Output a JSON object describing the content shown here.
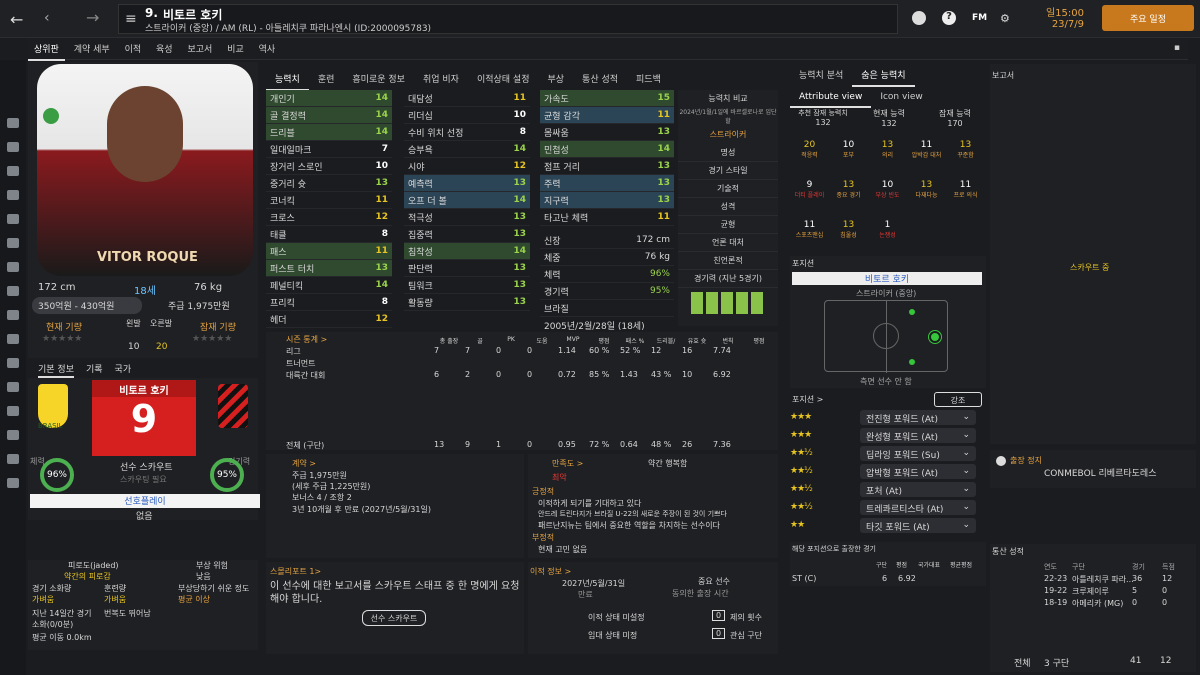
{
  "header": {
    "player_number": "9.",
    "player_name": "비토르 호키",
    "subtitle": "스트라이커 (중앙) / AM (RL) - 아틀레치쿠 파라나엔시 (ID:2000095783)",
    "time": "일15:00",
    "date": "23/7/9",
    "continue_label": "주요 일정",
    "fm_label": "FM"
  },
  "nav": [
    "상위판",
    "계약 세부",
    "이적",
    "육성",
    "보고서",
    "비교",
    "역사"
  ],
  "profile": {
    "height": "172 cm",
    "age": "18세",
    "weight": "76 kg",
    "value": "350억원 - 430억원",
    "wage": "주급 1,975만원",
    "current_ability_label": "현재 기량",
    "potential_label": "잠재 기량",
    "left_foot_label": "왼발",
    "right_foot_label": "오른발",
    "left_foot_val": "10",
    "right_foot_val": "20",
    "shirt_name": "VITOR ROQUE"
  },
  "tabs_info": [
    "기본 정보",
    "기록",
    "국가"
  ],
  "card": {
    "name": "비토르 호키",
    "number": "9",
    "scout_label": "선수 스카우트",
    "scout_sub": "스카우팅 필요",
    "left_pct": "96%",
    "right_pct": "95%",
    "left_label": "체력",
    "right_label": "경기력",
    "role_btn": "선호플레이",
    "role_val": "없음",
    "country": "BRASIL"
  },
  "condition": {
    "l1": "피로도(jaded)",
    "l1v": "약간의 피로감",
    "l2": "부상 위험",
    "l2v": "낮음",
    "l3": "경기 소화량",
    "l3v": "가벼움",
    "l4": "훈련량",
    "l4v": "가벼움",
    "l5": "부상당하기 쉬운 정도",
    "l5v": "평균 이상",
    "l6": "지난 14일간 경기",
    "l7": "소화(0/0분)",
    "l8": "번복도 뛰어남",
    "l9": "평균 이동 0.0km"
  },
  "attr_tabs": [
    "능력치",
    "훈련",
    "흥미로운 정보",
    "취업 비자",
    "이적상태 설정",
    "부상",
    "통산 성적",
    "피드백"
  ],
  "attrs_col1": [
    [
      "개인기",
      "14"
    ],
    [
      "골 결정력",
      "14"
    ],
    [
      "드리블",
      "14"
    ],
    [
      "일대일마크",
      "7"
    ],
    [
      "장거리 스로인",
      "10"
    ],
    [
      "중거리 슛",
      "13"
    ],
    [
      "코너킥",
      "11"
    ],
    [
      "크로스",
      "12"
    ],
    [
      "태클",
      "8"
    ],
    [
      "패스",
      "11"
    ],
    [
      "퍼스트 터치",
      "13"
    ],
    [
      "페널티킥",
      "14"
    ],
    [
      "프리킥",
      "8"
    ],
    [
      "헤더",
      "12"
    ]
  ],
  "attrs_col2": [
    [
      "대담성",
      "11"
    ],
    [
      "리더십",
      "10"
    ],
    [
      "수비 위치 선정",
      "8"
    ],
    [
      "승부욕",
      "14"
    ],
    [
      "시야",
      "12"
    ],
    [
      "예측력",
      "13"
    ],
    [
      "오프 더 볼",
      "14"
    ],
    [
      "적극성",
      "13"
    ],
    [
      "집중력",
      "13"
    ],
    [
      "침착성",
      "14"
    ],
    [
      "판단력",
      "13"
    ],
    [
      "팀워크",
      "13"
    ],
    [
      "활동량",
      "13"
    ]
  ],
  "attrs_col3": [
    [
      "가속도",
      "15"
    ],
    [
      "균형 감각",
      "11"
    ],
    [
      "몸싸움",
      "13"
    ],
    [
      "민첩성",
      "14"
    ],
    [
      "점프 거리",
      "13"
    ],
    [
      "주력",
      "13"
    ],
    [
      "지구력",
      "13"
    ],
    [
      "타고난 체력",
      "11"
    ]
  ],
  "phys": [
    [
      "신장",
      "172 cm"
    ],
    [
      "체중",
      "76 kg"
    ],
    [
      "체력",
      "96%"
    ],
    [
      "경기력",
      "95%"
    ]
  ],
  "phys_birth": "2005년/2월/28일 (18세)",
  "phys_nation": "브라질",
  "compare": {
    "title": "능력치 비교",
    "sub": "2024년/1월/1일에 바르셀로나로 입단할",
    "role": "스트라이커",
    "items": [
      "명성",
      "경기 스타일",
      "기술적",
      "성격",
      "균형",
      "언론 대처",
      "친언론적",
      "경기력 (지난 5경기)"
    ]
  },
  "season": {
    "title": "시즌 통계 >",
    "headers": [
      "총 출장",
      "골",
      "PK",
      "도움",
      "MVP",
      "평점",
      "패스 %",
      "드리블/",
      "유효 슛",
      "번칙",
      "평점"
    ],
    "rows": [
      [
        "리그",
        "7",
        "7",
        "0",
        "0",
        "1.14",
        "60 %",
        "52 %",
        "12",
        "16",
        "7.74"
      ],
      [
        "트너먼트",
        "",
        "",
        "",
        "",
        "",
        "",
        "",
        "",
        "",
        ""
      ],
      [
        "대륙간 대회",
        "6",
        "2",
        "0",
        "0",
        "0.72",
        "85 %",
        "1.43",
        "43 %",
        "10",
        "6.92"
      ]
    ],
    "total": [
      "전체 (구단)",
      "13",
      "9",
      "1",
      "0",
      "0.95",
      "72 %",
      "0.64",
      "48 %",
      "26",
      "7.36"
    ]
  },
  "contract": {
    "title": "계약 >",
    "wage": "주급 1,975만원",
    "detail": "(세후 주급 1,225만원)",
    "bonus": "보너스 4 / 조항 2",
    "end": "3년 10개월 후 만료 (2027년/5월/31일)"
  },
  "happiness": {
    "title": "만족도 >",
    "status": "최악",
    "label": "약간 행복함",
    "pos_title": "긍정적",
    "pos": [
      "이적하게 되기를 기대하고 있다",
      "안드레 트린다지가 브라질 U-22의 새로운 주장이 된 것이 기쁘다",
      "패르난지뉴는 팀에서 중요한 역할을 차지하는 선수이다"
    ],
    "neg_title": "부정적",
    "neg": [
      "현재 고민 없음"
    ]
  },
  "scout_report": {
    "title": "스몰리포트 1>",
    "text": "이 선수에 대한 보고서를 스카우트 스태프 중 한 명에게 요청해야 합니다.",
    "button": "선수 스카우트"
  },
  "transfer": {
    "title": "이적 정보 >",
    "date": "2027년/5월/31일",
    "date_sub": "만료",
    "importance": "중요 선수",
    "importance_sub": "동의한 출장 시간",
    "s1": "이적 상태 미설정",
    "s2": "임대 상태 미정",
    "n1": "0",
    "n1l": "제의 횟수",
    "n2": "0",
    "n2l": "관심 구단"
  },
  "right_tabs": [
    "능력치 분석",
    "숨은 능력치"
  ],
  "view_tabs": [
    "Attribute view",
    "Icon view"
  ],
  "ability": {
    "h1": "추천 잠재 능력치",
    "v1": "132",
    "h2": "현재 능력",
    "v2": "132",
    "h3": "잠재 능력",
    "v3": "170"
  },
  "hidden": [
    [
      "20",
      "적응력"
    ],
    [
      "10",
      "포부"
    ],
    [
      "13",
      "의리"
    ],
    [
      "11",
      "압박감 대처"
    ],
    [
      "13",
      "꾸준함"
    ],
    [
      "9",
      "더티 플레이"
    ],
    [
      "13",
      "중요 경기"
    ],
    [
      "10",
      "부상 빈도"
    ],
    [
      "13",
      "다재다능"
    ],
    [
      "11",
      "프로 의식"
    ],
    [
      "11",
      "스포츠맨십"
    ],
    [
      "13",
      "침울성"
    ],
    [
      "1",
      "논쟁성"
    ]
  ],
  "position": {
    "title": "포지션",
    "name": "비토르 호키",
    "sub": "스트라이커 (중앙)",
    "note": "측면 선수 안 함",
    "roles_title": "포지션 >",
    "strong": "강조"
  },
  "roles": [
    "전진형 포워드 (At)",
    "완성형 포워드 (At)",
    "딥라잉 포워드 (Su)",
    "압박형 포워드 (At)",
    "포처 (At)",
    "트레콰르티스타 (At)",
    "타깃 포워드 (At)"
  ],
  "role_stars": [
    3,
    3,
    2.5,
    2.5,
    2.5,
    2.5,
    2
  ],
  "played": {
    "title": "해당 포지션으로 출장한 경기",
    "h": [
      "구단",
      "평점",
      "국가대표",
      "평균평점"
    ],
    "pos": "ST (C)",
    "apps": "6",
    "rating": "6.92"
  },
  "report": {
    "title": "보고서",
    "scouting": "스카우트 중"
  },
  "ban": {
    "title": "출장 정지",
    "item": "CONMEBOL 리베르타도레스"
  },
  "career": {
    "title": "통산 성적",
    "h": [
      "연도",
      "구단",
      "경기",
      "득점"
    ],
    "rows": [
      [
        "22-23",
        "아틀레치쿠 파라...",
        "36",
        "12"
      ],
      [
        "19-22",
        "크루제이루",
        "5",
        "0"
      ],
      [
        "18-19",
        "아메리카 (MG)",
        "0",
        "0"
      ]
    ],
    "total": [
      "전체",
      "3 구단",
      "41",
      "12"
    ]
  }
}
